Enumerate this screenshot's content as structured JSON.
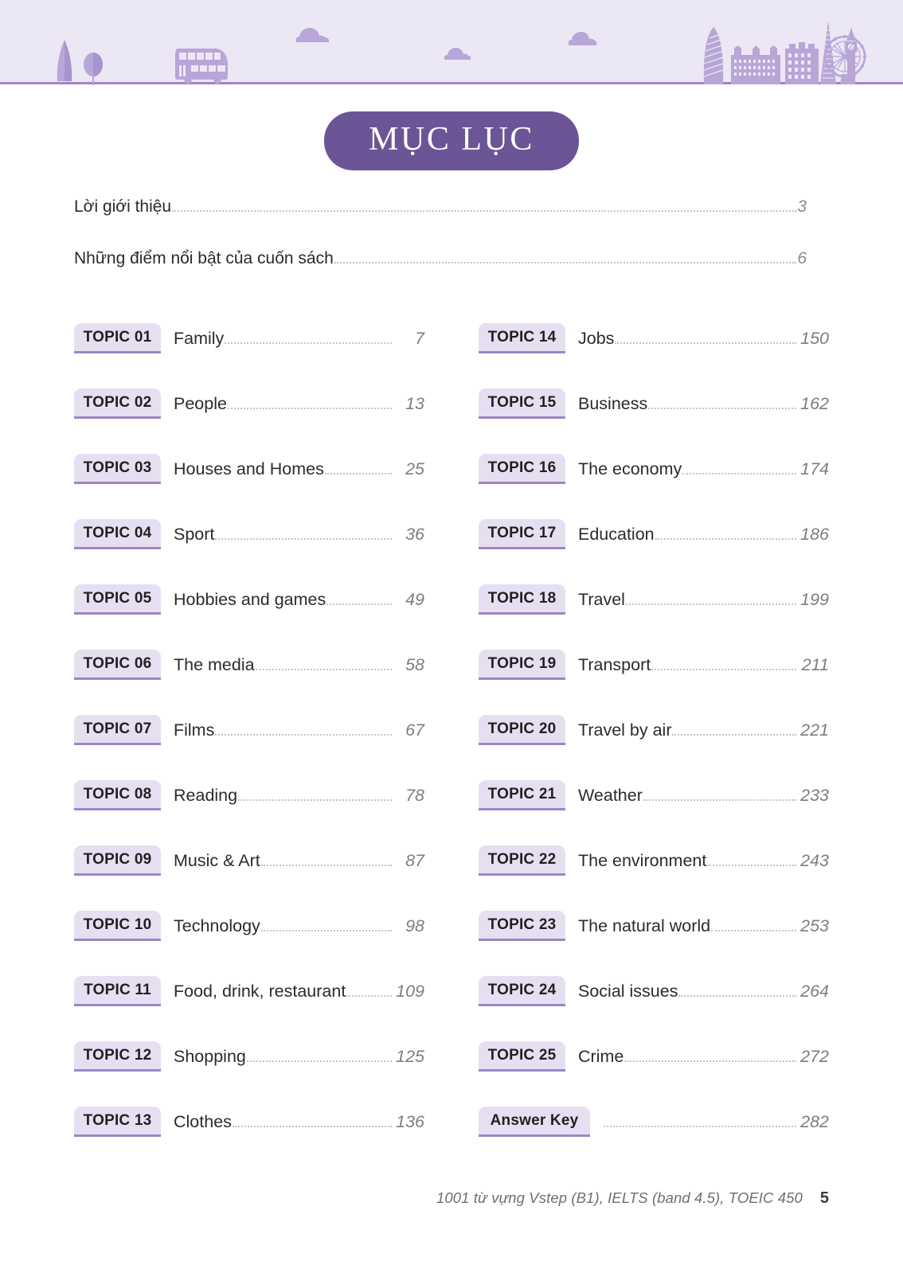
{
  "header": {
    "band_color": "#ece7f4",
    "band_border_color": "#9d86c6",
    "decor_color": "#b7a6d7",
    "decor_color_light": "#c4b5de",
    "icons": [
      "cypress-tree-icon",
      "round-tree-icon",
      "double-decker-bus-icon",
      "cloud-icon",
      "cloud-icon",
      "cloud-icon",
      "gherkin-building-icon",
      "houses-of-parliament-icon",
      "office-building-icon",
      "the-shard-icon",
      "big-ben-icon",
      "london-eye-icon"
    ]
  },
  "title": {
    "text": "MỤC LỤC",
    "pill_color": "#6b5596",
    "text_color": "#ffffff"
  },
  "intro": [
    {
      "label": "Lời giới thiệu",
      "page": "3"
    },
    {
      "label": "Những điểm nổi bật của cuốn sách",
      "page": "6"
    }
  ],
  "columns": {
    "left": [
      {
        "badge": "TOPIC 01",
        "title": "Family",
        "page": "7"
      },
      {
        "badge": "TOPIC 02",
        "title": "People",
        "page": "13"
      },
      {
        "badge": "TOPIC 03",
        "title": "Houses and Homes",
        "page": "25"
      },
      {
        "badge": "TOPIC 04",
        "title": "Sport",
        "page": "36"
      },
      {
        "badge": "TOPIC 05",
        "title": "Hobbies and games",
        "page": "49"
      },
      {
        "badge": "TOPIC 06",
        "title": "The media",
        "page": "58"
      },
      {
        "badge": "TOPIC 07",
        "title": "Films",
        "page": "67"
      },
      {
        "badge": "TOPIC 08",
        "title": "Reading",
        "page": "78"
      },
      {
        "badge": "TOPIC 09",
        "title": "Music & Art",
        "page": "87"
      },
      {
        "badge": "TOPIC 10",
        "title": "Technology",
        "page": "98"
      },
      {
        "badge": "TOPIC 11",
        "title": "Food, drink, restaurant",
        "page": "109"
      },
      {
        "badge": "TOPIC 12",
        "title": "Shopping",
        "page": "125"
      },
      {
        "badge": "TOPIC 13",
        "title": "Clothes",
        "page": "136"
      }
    ],
    "right": [
      {
        "badge": "TOPIC 14",
        "title": "Jobs",
        "page": "150"
      },
      {
        "badge": "TOPIC 15",
        "title": "Business",
        "page": "162"
      },
      {
        "badge": "TOPIC 16",
        "title": "The economy",
        "page": "174"
      },
      {
        "badge": "TOPIC 17",
        "title": "Education",
        "page": "186"
      },
      {
        "badge": "TOPIC 18",
        "title": "Travel",
        "page": "199"
      },
      {
        "badge": "TOPIC 19",
        "title": "Transport",
        "page": "211"
      },
      {
        "badge": "TOPIC 20",
        "title": "Travel by air",
        "page": "221"
      },
      {
        "badge": "TOPIC 21",
        "title": "Weather",
        "page": "233"
      },
      {
        "badge": "TOPIC 22",
        "title": "The environment",
        "page": "243"
      },
      {
        "badge": "TOPIC 23",
        "title": "The natural world",
        "page": "253"
      },
      {
        "badge": "TOPIC 24",
        "title": "Social issues",
        "page": "264"
      },
      {
        "badge": "TOPIC 25",
        "title": "Crime",
        "page": "272"
      },
      {
        "badge": "Answer Key",
        "title": "",
        "page": "282",
        "wide": true
      }
    ]
  },
  "footer": {
    "text": "1001 từ vựng Vstep (B1), IELTS (band 4.5), TOEIC 450",
    "page_number": "5"
  },
  "colors": {
    "accent": "#6b5596",
    "badge_fill": "#e6dff1",
    "badge_border": "#9d86c6",
    "leader_dots": "#c4c4c4",
    "page_number_text": "#7d7d7d"
  }
}
